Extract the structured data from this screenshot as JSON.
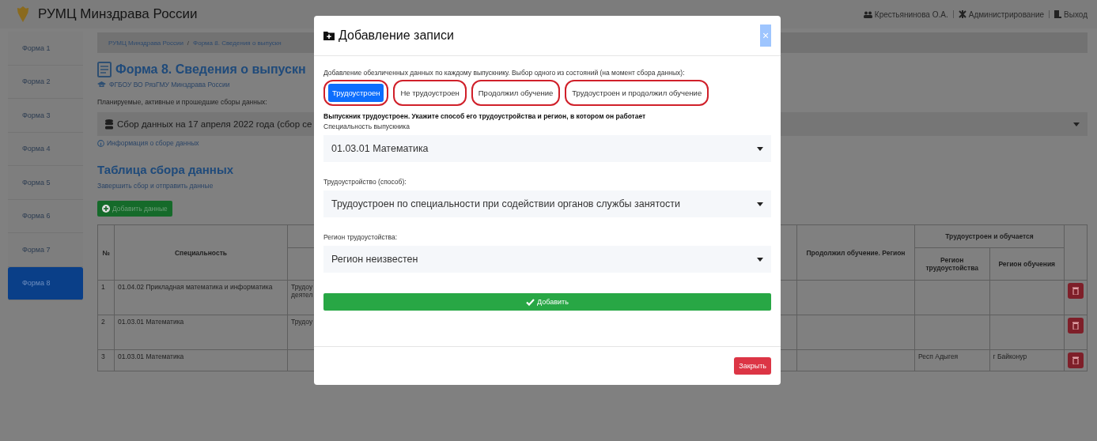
{
  "header": {
    "title": "РУМЦ Минздрава России",
    "user": "Крестьянинова О.А.",
    "admin": "Администрирование",
    "logout": "Выход"
  },
  "sidebar": {
    "items": [
      {
        "label": "Форма 1",
        "selected": false
      },
      {
        "label": "Форма 2",
        "selected": false
      },
      {
        "label": "Форма 3",
        "selected": false
      },
      {
        "label": "Форма 4",
        "selected": false
      },
      {
        "label": "Форма 5",
        "selected": false
      },
      {
        "label": "Форма 6",
        "selected": false
      },
      {
        "label": "Форма 7",
        "selected": false
      },
      {
        "label": "Форма 8",
        "selected": true
      }
    ]
  },
  "breadcrumb": {
    "separator": "/",
    "items": [
      "РУМЦ Минздрава России",
      "Форма 8. Сведения о выпускн"
    ]
  },
  "page": {
    "title": "Форма 8. Сведения о выпускн",
    "organization": "ФГБОУ ВО РязГМУ Минздрава России",
    "collections_label": "Планируемые, активные и прошедшие сборы данных:",
    "collection_select": "Сбор данных на 17 апреля 2022 года (сбор се",
    "info_link": "Информация о сборе данных",
    "table_title": "Таблица сбора данных",
    "finish_link": "Завершить сбор и отправить данные",
    "add_button": "Добавить данные"
  },
  "table": {
    "columns": [
      {
        "label": "№"
      },
      {
        "label": "Специальность"
      },
      {
        "label": "Продолжил обучение. Регион"
      },
      {
        "label": "Трудоустроен и обучается",
        "children": [
          "Регион трудоустойства",
          "Регион обучения"
        ]
      }
    ],
    "rows": [
      {
        "number": "1",
        "specialty": "01.04.02 Прикладная математика и информатика",
        "column_3": "Трудоу\nдеятел"
      },
      {
        "number": "2",
        "specialty": "01.03.01 Математика",
        "column_3": "Трудоу"
      },
      {
        "number": "3",
        "specialty": "01.03.01 Математика",
        "work_region": "Респ Адыгея",
        "study_region": "г Байконур"
      }
    ]
  },
  "modal": {
    "title": "Добавление записи",
    "close": "×",
    "description": "Добавление обезличенных данных по каждому выпускнику. Выбор одного из состояний (на момент сбора данных):",
    "states": [
      {
        "label": "Трудоустроен",
        "selected": true,
        "highlighted": true
      },
      {
        "label": "Не трудоустроен",
        "selected": false,
        "highlighted": true
      },
      {
        "label": "Продолжил обучение",
        "selected": false,
        "highlighted": true
      },
      {
        "label": "Трудоустроен и продолжил обучение",
        "selected": false,
        "highlighted": true
      }
    ],
    "instruction": "Выпускник трудоустроен. Укажите способ его трудоустройства и регион, в котором он работает",
    "fields": [
      {
        "label": "Специальность выпускника",
        "value": "01.03.01 Математика"
      },
      {
        "label": "Трудоустройство (способ):",
        "value": "Трудоустроен по специальности при содействии органов службы занятости"
      },
      {
        "label": "Регион трудоустойства:",
        "value": "Регион неизвестен"
      }
    ],
    "submit": "Добавить",
    "dismiss": "Закрыть"
  }
}
